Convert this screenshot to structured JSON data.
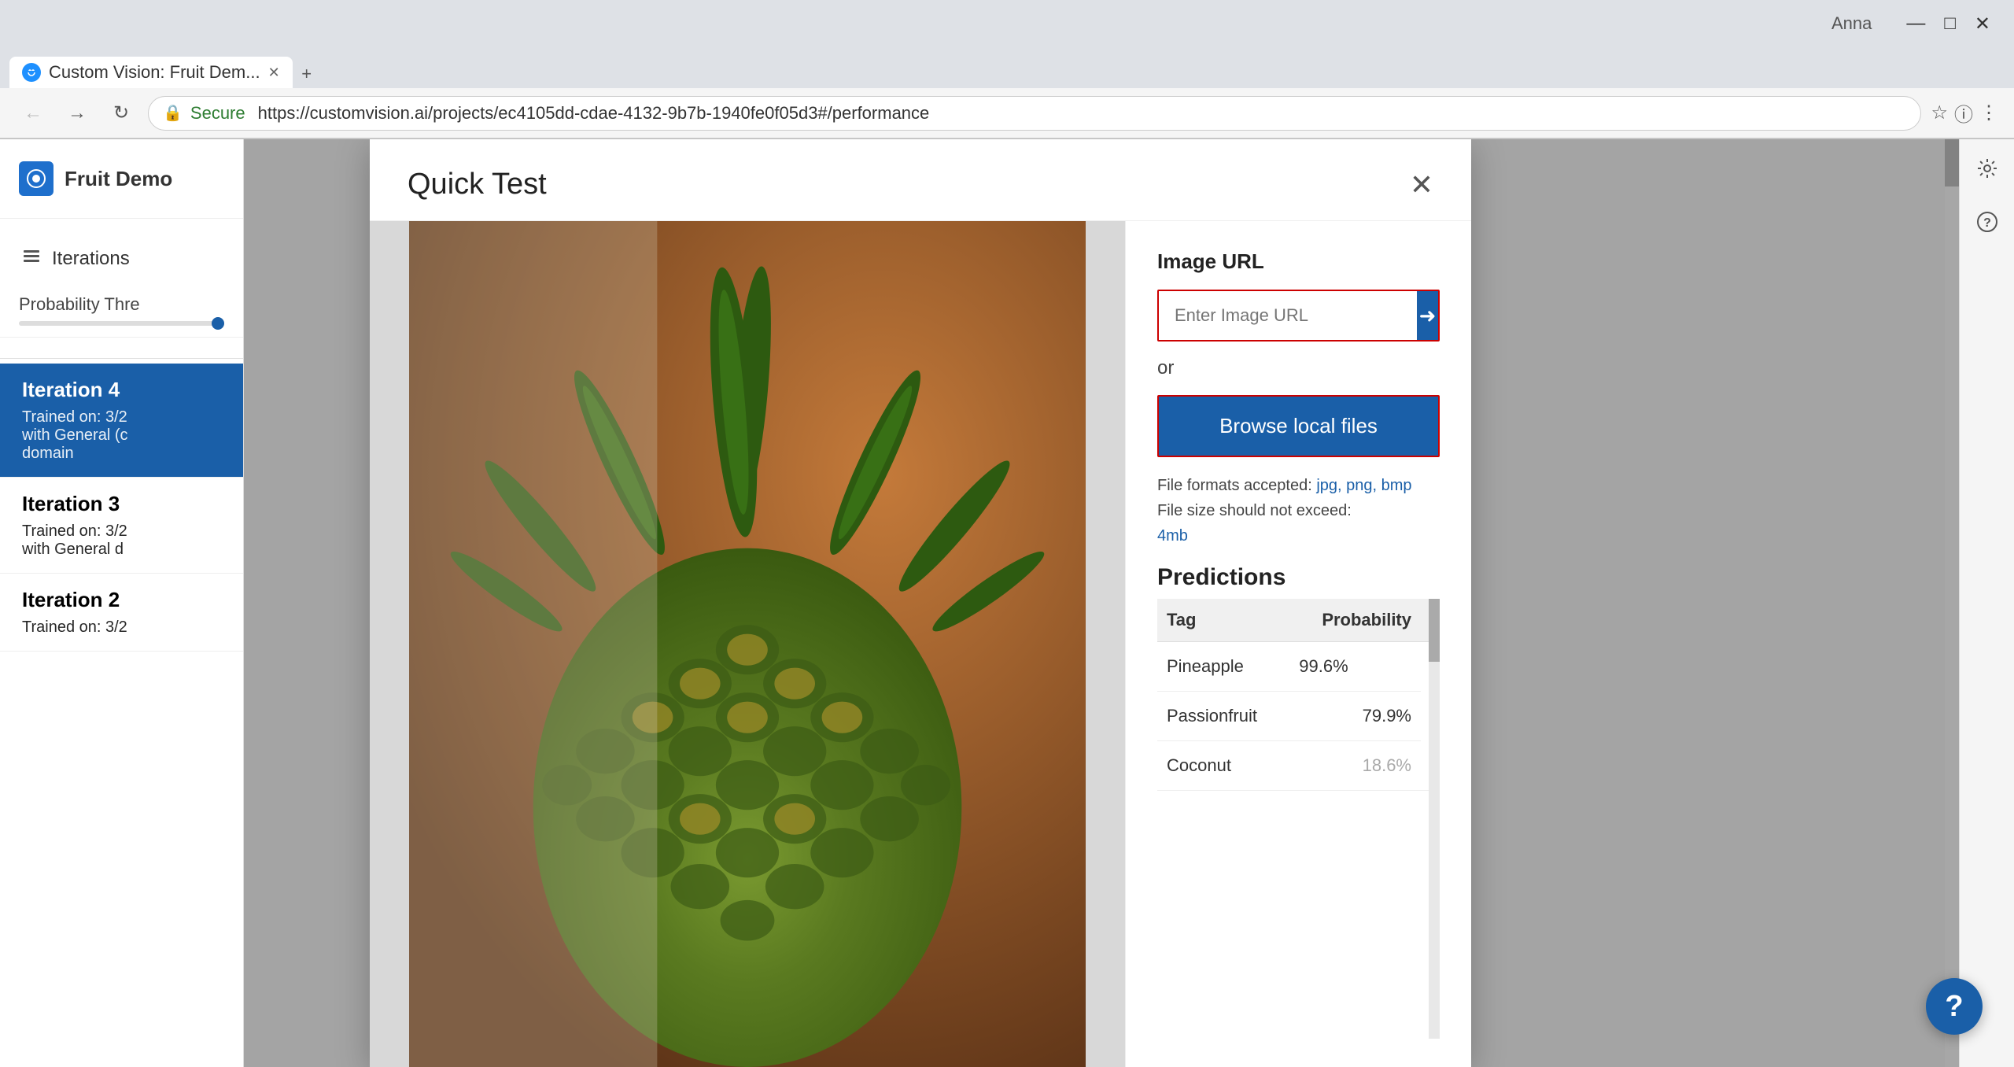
{
  "browser": {
    "tab_title": "Custom Vision: Fruit Dem...",
    "url": "https://customvision.ai/projects/ec4105dd-cdae-4132-9b7b-1940fe0f05d3#/performance",
    "user": "Anna",
    "secure_label": "Secure"
  },
  "sidebar": {
    "logo_icon": "eye-icon",
    "title": "Fruit Demo",
    "nav_items": [
      {
        "label": "Iterations",
        "icon": "layers-icon"
      }
    ],
    "prob_threshold_label": "Probability Thre",
    "iterations": [
      {
        "id": "iter4",
        "title": "Iteration 4",
        "subtitle": "Trained on: 3/2\nwith General (c\ndomain",
        "active": true
      },
      {
        "id": "iter3",
        "title": "Iteration 3",
        "subtitle": "Trained on: 3/2\nwith General d",
        "active": false
      },
      {
        "id": "iter2",
        "title": "Iteration 2",
        "subtitle": "Trained on: 3/2",
        "active": false
      }
    ]
  },
  "modal": {
    "title": "Quick Test",
    "close_icon": "close-icon",
    "image_url_label": "Image URL",
    "url_placeholder": "Enter Image URL",
    "url_submit_icon": "arrow-right-icon",
    "or_text": "or",
    "browse_label": "Browse local files",
    "file_formats_text": "File formats accepted: ",
    "file_formats_links": "jpg, png, bmp",
    "file_size_text": "File size should not exceed:",
    "file_size_limit": "4mb",
    "predictions_label": "Predictions",
    "table_headers": [
      "Tag",
      "Probability"
    ],
    "predictions": [
      {
        "tag": "Pineapple",
        "probability": "99.6%"
      },
      {
        "tag": "Passionfruit",
        "probability": "79.9%"
      },
      {
        "tag": "Coconut",
        "probability": "18.6%"
      }
    ]
  },
  "help_btn_label": "?",
  "right_icons": {
    "settings_icon": "gear-icon",
    "help_icon": "question-icon"
  }
}
